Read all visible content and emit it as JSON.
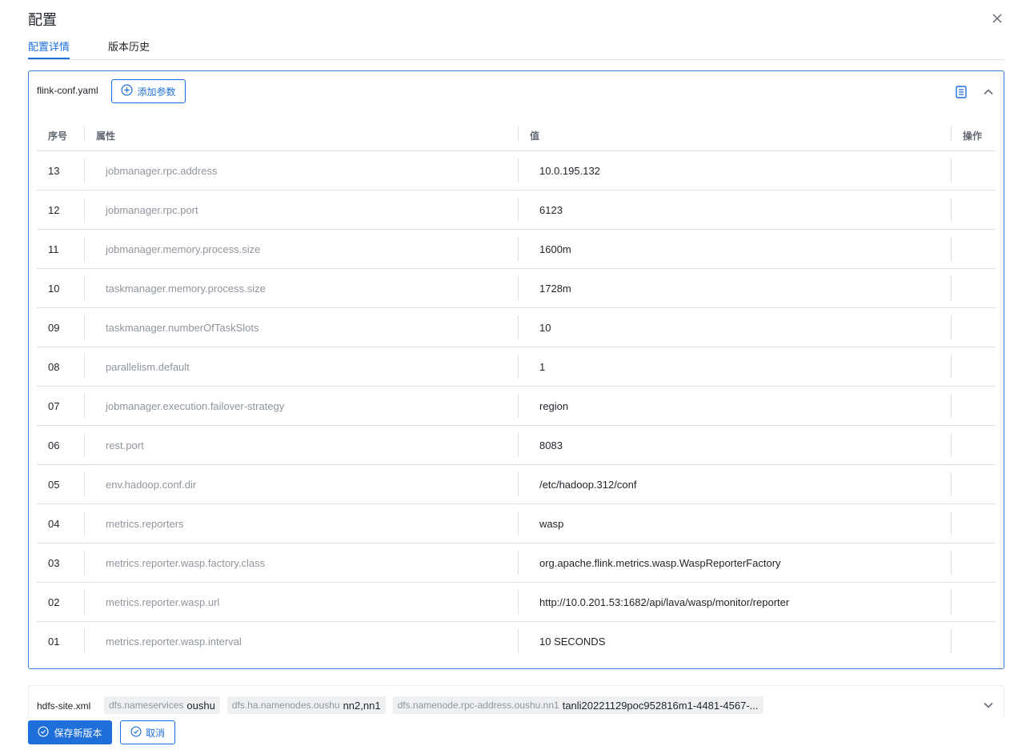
{
  "dialog": {
    "title": "配置"
  },
  "tabs": [
    {
      "label": "配置详情",
      "active": true
    },
    {
      "label": "版本历史",
      "active": false
    }
  ],
  "panel": {
    "file_name": "flink-conf.yaml",
    "add_param_label": "添加参数",
    "columns": {
      "index": "序号",
      "property": "属性",
      "value": "值",
      "action": "操作"
    },
    "rows": [
      {
        "index": "13",
        "key": "jobmanager.rpc.address",
        "value": "10.0.195.132"
      },
      {
        "index": "12",
        "key": "jobmanager.rpc.port",
        "value": "6123"
      },
      {
        "index": "11",
        "key": "jobmanager.memory.process.size",
        "value": "1600m"
      },
      {
        "index": "10",
        "key": "taskmanager.memory.process.size",
        "value": "1728m"
      },
      {
        "index": "09",
        "key": "taskmanager.numberOfTaskSlots",
        "value": "10"
      },
      {
        "index": "08",
        "key": "parallelism.default",
        "value": "1"
      },
      {
        "index": "07",
        "key": "jobmanager.execution.failover-strategy",
        "value": "region"
      },
      {
        "index": "06",
        "key": "rest.port",
        "value": "8083"
      },
      {
        "index": "05",
        "key": "env.hadoop.conf.dir",
        "value": "/etc/hadoop.312/conf"
      },
      {
        "index": "04",
        "key": "metrics.reporters",
        "value": "wasp"
      },
      {
        "index": "03",
        "key": "metrics.reporter.wasp.factory.class",
        "value": "org.apache.flink.metrics.wasp.WaspReporterFactory"
      },
      {
        "index": "02",
        "key": "metrics.reporter.wasp.url",
        "value": "http://10.0.201.53:1682/api/lava/wasp/monitor/reporter"
      },
      {
        "index": "01",
        "key": "metrics.reporter.wasp.interval",
        "value": "10 SECONDS"
      }
    ]
  },
  "panel2": {
    "file_name": "hdfs-site.xml",
    "tags": [
      {
        "key": "dfs.nameservices",
        "value": "oushu"
      },
      {
        "key": "dfs.ha.namenodes.oushu",
        "value": "nn2,nn1"
      },
      {
        "key": "dfs.namenode.rpc-address.oushu.nn1",
        "value": "tanli20221129poc952816m1-4481-4567-..."
      }
    ]
  },
  "footer": {
    "save_label": "保存新版本",
    "cancel_label": "取消"
  },
  "colors": {
    "accent": "#1e6fd9",
    "border": "#dee0e3",
    "muted_text": "#8f959e"
  },
  "icons": {
    "close": "close-icon",
    "add": "plus-circle-icon",
    "doc": "document-icon",
    "collapse": "chevron-up-icon",
    "expand": "chevron-down-icon",
    "check": "check-circle-icon"
  }
}
